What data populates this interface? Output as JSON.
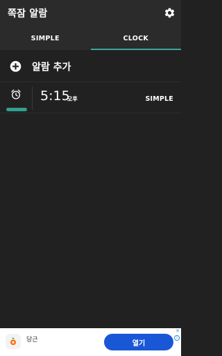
{
  "app": {
    "title": "쪽잠 알람"
  },
  "tabs": [
    {
      "label": "SIMPLE",
      "active": false
    },
    {
      "label": "CLOCK",
      "active": true
    }
  ],
  "add_alarm": {
    "label": "알람 추가"
  },
  "alarms": [
    {
      "time": "5:15",
      "ampm": "오후",
      "mode": "SIMPLE",
      "enabled": true
    }
  ],
  "ad": {
    "name": "당근",
    "button_label": "열기"
  },
  "colors": {
    "background": "#212121",
    "bar": "#2b2b2b",
    "accent": "#3aa79c",
    "ad_button": "#1a57d6"
  }
}
